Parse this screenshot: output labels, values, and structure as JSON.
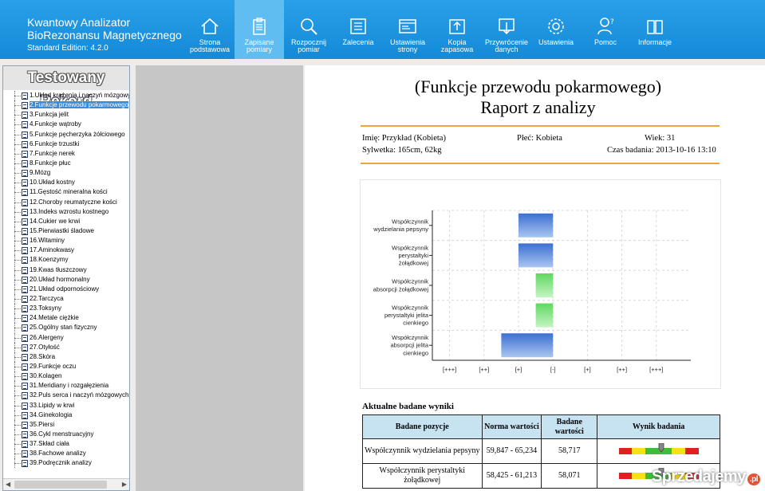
{
  "brand": {
    "line1": "Kwantowy Analizator",
    "line2": "BioRezonansu Magnetycznego",
    "edition": "Standard Edition: 4.2.0"
  },
  "nav": [
    {
      "label": "Strona podstawowa",
      "icon": "home-icon"
    },
    {
      "label": "Zapisane pomiary",
      "icon": "clipboard-icon"
    },
    {
      "label": "Rozpocznij pomiar",
      "icon": "magnifier-icon"
    },
    {
      "label": "Zalecenia",
      "icon": "list-icon"
    },
    {
      "label": "Ustawienia strony",
      "icon": "window-icon"
    },
    {
      "label": "Kopia zapasowa",
      "icon": "upload-icon"
    },
    {
      "label": "Przywrócenie danych",
      "icon": "download-icon"
    },
    {
      "label": "Ustawienia",
      "icon": "gear-icon"
    },
    {
      "label": "Pomoc",
      "icon": "help-icon"
    },
    {
      "label": "Informacje",
      "icon": "book-icon"
    }
  ],
  "nav_active": 1,
  "sidebar": {
    "title": "Testowany Rekord",
    "selected": 1,
    "items": [
      "1.Układ krążenia i naczyń mózgowych",
      "2.Funkcje przewodu pokarmowego",
      "3.Funkcja jelit",
      "4.Funkcje wątroby",
      "5.Funkcje pęcherzyka żółciowego",
      "6.Funkcje trzustki",
      "7.Funkcje nerek",
      "8.Funkcje płuc",
      "9.Mózg",
      "10.Układ kostny",
      "11.Gęstość mineralna kości",
      "12.Choroby reumatyczne kości",
      "13.Indeks wzrostu kostnego",
      "14.Cukier we krwi",
      "15.Pierwiastki śladowe",
      "16.Witaminy",
      "17.Aminokwasy",
      "18.Koenzymy",
      "19.Kwas tłuszczowy",
      "20.Układ hormonalny",
      "21.Układ odpornościowy",
      "22.Tarczyca",
      "23.Toksyny",
      "24.Metale ciężkie",
      "25.Ogólny stan fizyczny",
      "26.Alergeny",
      "27.Otyłość",
      "28.Skóra",
      "29.Funkcje oczu",
      "30.Kolagen",
      "31.Meridiany i rozgałęzienia",
      "32.Puls serca i naczyń mózgowych",
      "33.Lipidy w krwi",
      "34.Ginekologia",
      "35.Piersi",
      "36.Cykl menstruacyjny",
      "37.Skład ciała",
      "38.Fachowe analizy",
      "39.Podręcznik analizy"
    ]
  },
  "report": {
    "title1": "(Funkcje przewodu pokarmowego)",
    "title2": "Raport z analizy",
    "name": "Imię: Przykład (Kobieta)",
    "sex": "Płeć: Kobieta",
    "age": "Wiek: 31",
    "figure": "Sylwetka: 165cm, 62kg",
    "date": "Czas badania: 2013-10-16 13:10",
    "table_caption": "Aktualne badane wyniki",
    "headers": [
      "Badane pozycje",
      "Norma wartości",
      "Badane wartości",
      "Wynik badania"
    ],
    "rows": [
      {
        "name": "Współczynnik wydzielania pepsyny",
        "norm": "59,847 - 65,234",
        "value": "58,717",
        "marker": 0.53
      },
      {
        "name": "Współczynnik perystaltyki żołądkowej",
        "norm": "58,425 - 61,213",
        "value": "58,071",
        "marker": 0.53
      }
    ]
  },
  "chart_data": {
    "type": "bar",
    "orientation": "horizontal",
    "categories": [
      "Współczynnik wydzielania pepsyny",
      "Współczynnik perystaltyki żołądkowej",
      "Współczynnik absorpcji żołądkowej",
      "Współczynnik perystaltyki jelita cienkiego",
      "Współczynnik absorpcji jelita cienkiego"
    ],
    "values": [
      -1,
      -1,
      -0.5,
      -0.5,
      -1.5
    ],
    "colors": [
      "#4d7fd6",
      "#4d7fd6",
      "#6ee06e",
      "#6ee06e",
      "#4d7fd6"
    ],
    "tick_labels": [
      "[+++]",
      "[++]",
      "[+]",
      "[-]",
      "[+]",
      "[++]",
      "[+++]"
    ],
    "xlim": [
      -3.5,
      4
    ],
    "grid": true
  },
  "watermark": {
    "text": "Sprzedajemy",
    "suffix": ".pl"
  }
}
